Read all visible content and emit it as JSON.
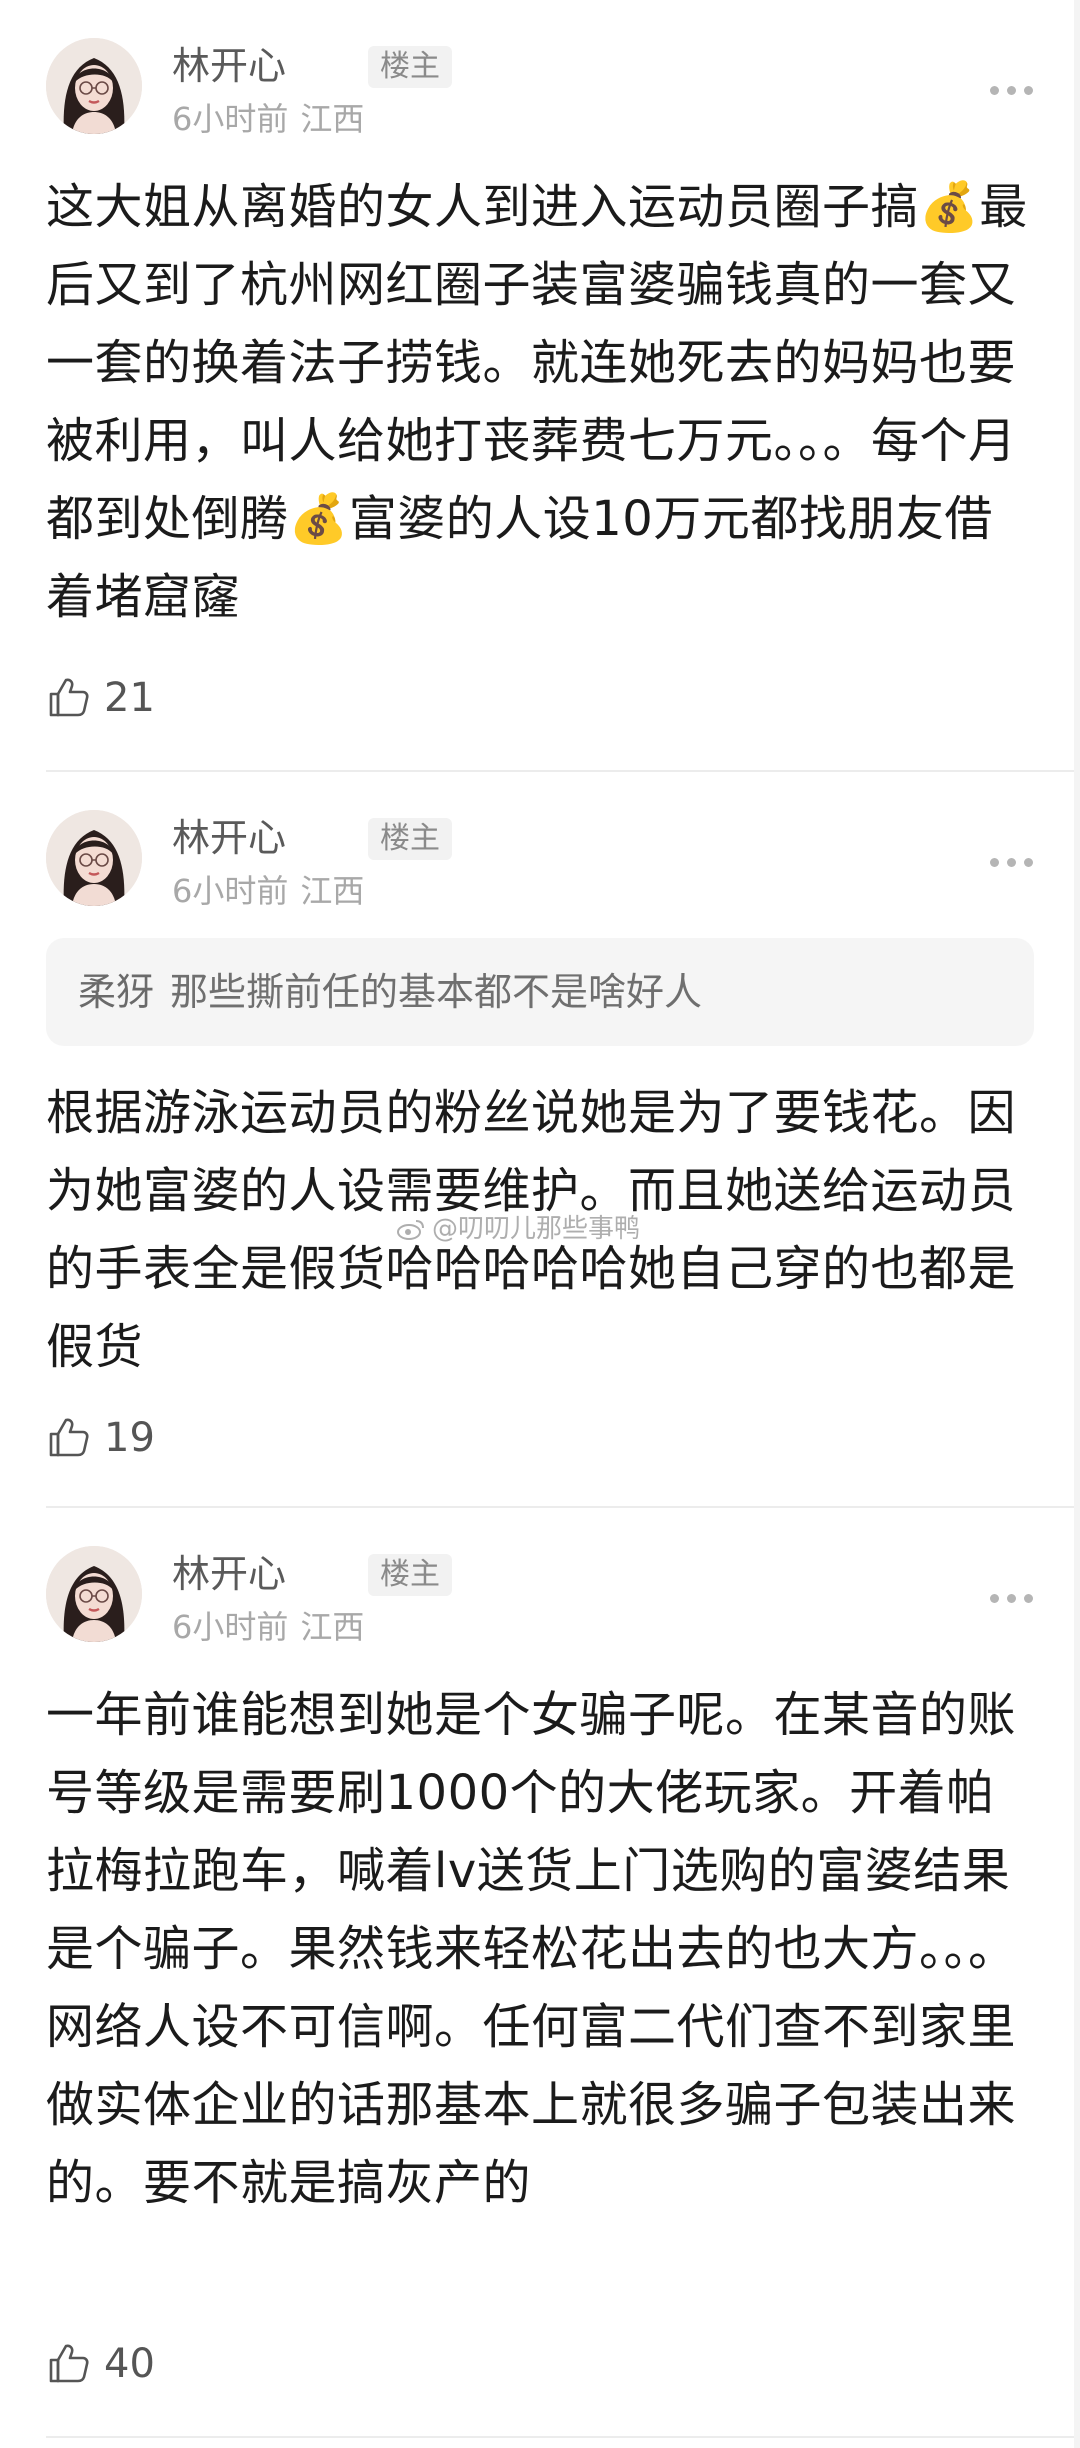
{
  "posts": [
    {
      "author": "林开心",
      "badge": "楼主",
      "time": "6小时前",
      "location": "江西",
      "text": "这大姐从离婚的女人到进入运动员圈子搞💰最后又到了杭州网红圈子装富婆骗钱真的一套又一套的换着法子捞钱。就连她死去的妈妈也要被利用，叫人给她打丧葬费七万元。。。每个月都到处倒腾💰富婆的人设10万元都找朋友借着堵窟窿",
      "likes": "21"
    },
    {
      "author": "林开心",
      "badge": "楼主",
      "time": "6小时前",
      "location": "江西",
      "quote_name": "柔犽",
      "quote_text": "那些撕前任的基本都不是啥好人",
      "text": "根据游泳运动员的粉丝说她是为了要钱花。因为她富婆的人设需要维护。而且她送给运动员的手表全是假货哈哈哈哈哈她自己穿的也都是假货",
      "likes": "19"
    },
    {
      "author": "林开心",
      "badge": "楼主",
      "time": "6小时前",
      "location": "江西",
      "text": "一年前谁能想到她是个女骗子呢。在某音的账号等级是需要刷1000个的大佬玩家。开着帕拉梅拉跑车，喊着lv送货上门选购的富婆结果是个骗子。果然钱来轻松花出去的也大方。。。网络人设不可信啊。任何富二代们查不到家里做实体企业的话那基本上就很多骗子包装出来的。要不就是搞灰产的",
      "likes": "40"
    }
  ],
  "watermark": "@叨叨儿那些事鸭",
  "icons": {
    "avatar": "avatar-woman-with-glasses",
    "more": "more-dots-icon",
    "like": "thumbs-up-icon",
    "watermark": "weibo-logo-icon"
  },
  "colors": {
    "text": "#1b1b1b",
    "meta": "#a8a8a8",
    "badge_bg": "#f2f2f2",
    "quote_bg": "#f5f5f5",
    "separator": "#ececec"
  }
}
